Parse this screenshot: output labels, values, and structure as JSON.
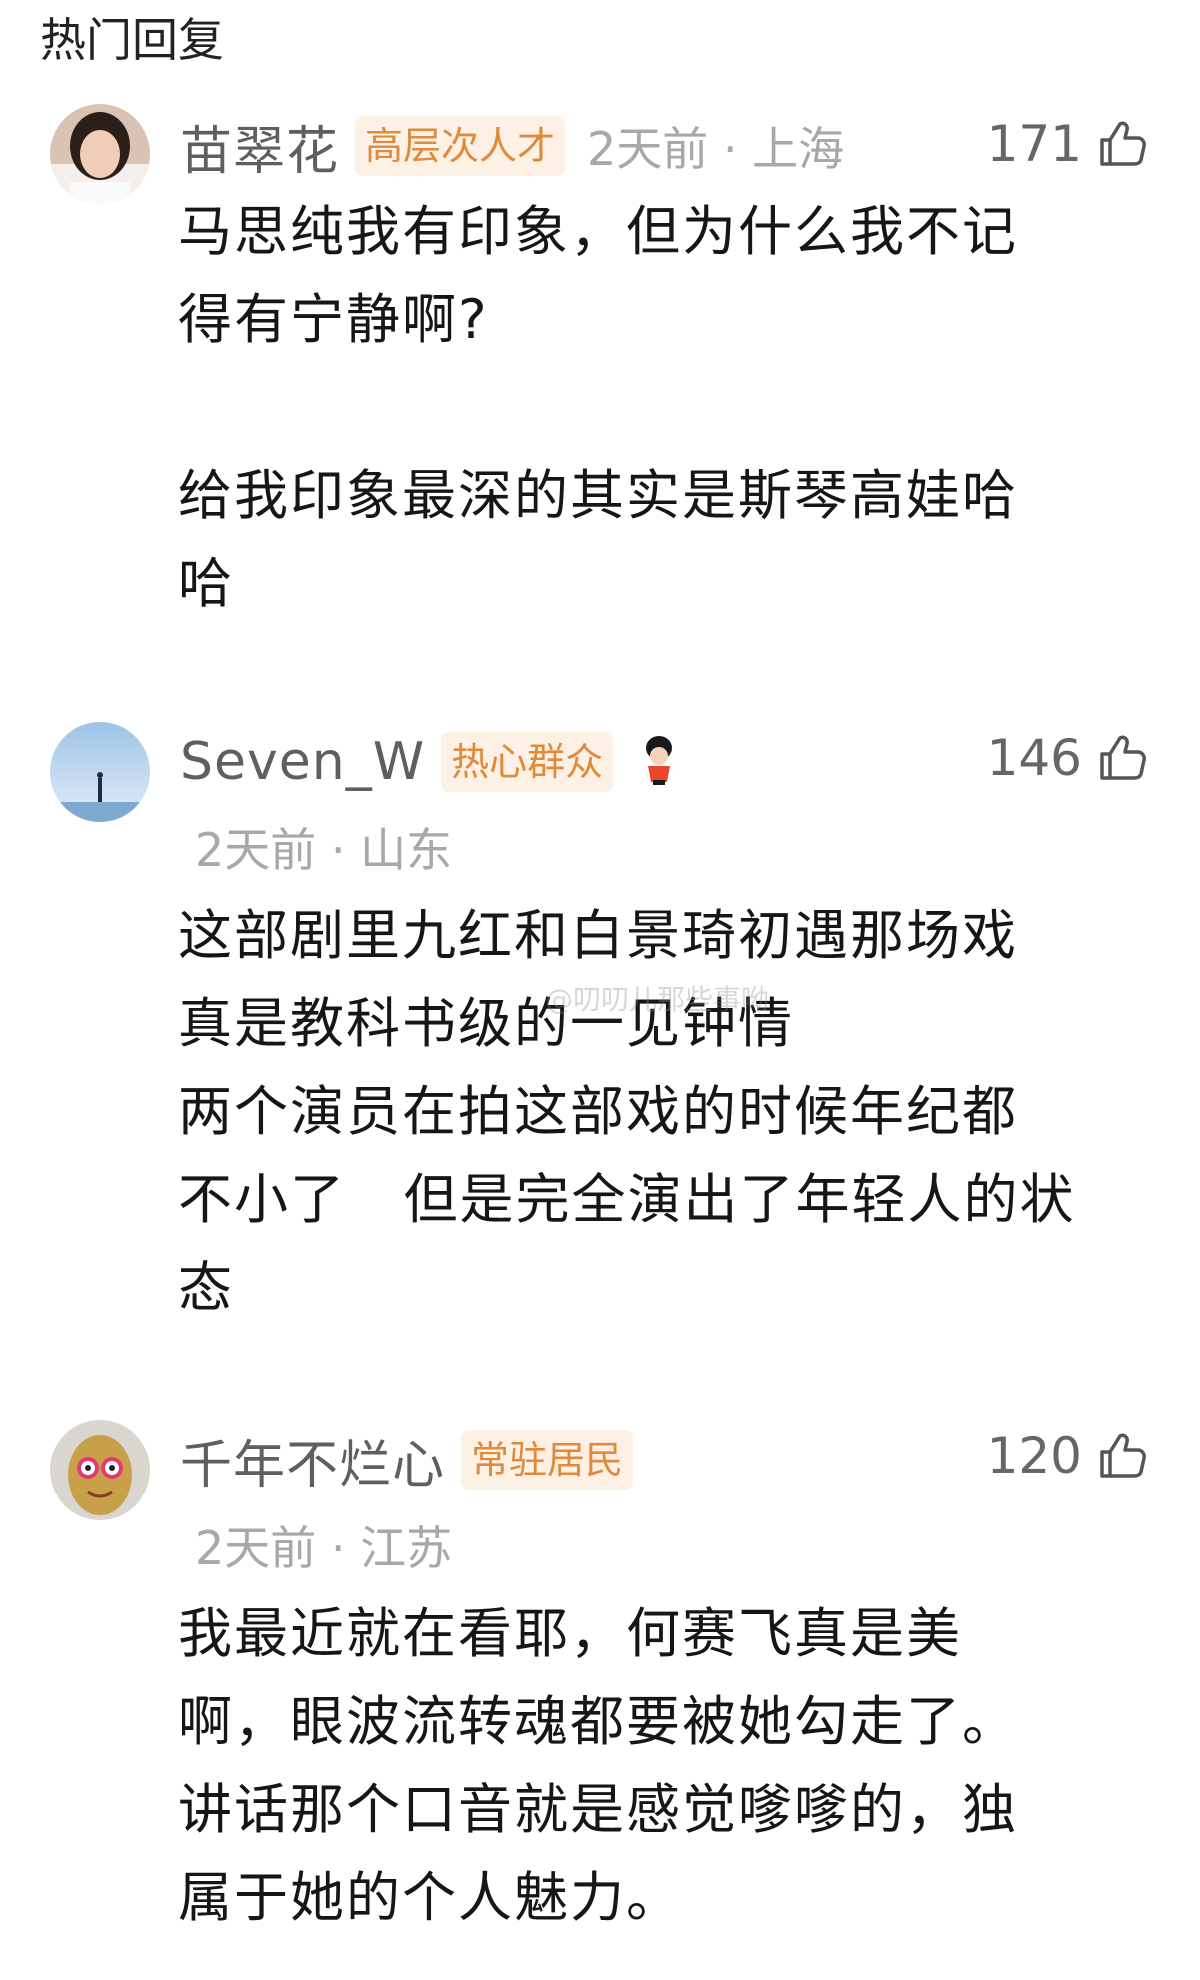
{
  "section": {
    "title": "热门回复"
  },
  "comments": [
    {
      "username": "苗翠花",
      "badge": "高层次人才",
      "time_location": "2天前 · 上海",
      "likes": "171",
      "text": "马思纯我有印象，但为什么我不记\n得有宁静啊?\n\n给我印象最深的其实是斯琴高娃哈\n哈"
    },
    {
      "username": "Seven_W",
      "badge": "热心群众",
      "time_location": "2天前 · 山东",
      "likes": "146",
      "text": "这部剧里九红和白景琦初遇那场戏\n真是教科书级的一见钟情\n两个演员在拍这部戏的时候年纪都\n不小了   但是完全演出了年轻人的状\n态"
    },
    {
      "username": "千年不烂心",
      "badge": "常驻居民",
      "time_location": "2天前 · 江苏",
      "likes": "120",
      "text": "我最近就在看耶，何赛飞真是美\n啊，眼波流转魂都要被她勾走了。\n讲话那个口音就是感觉嗲嗲的，独\n属于她的个人魅力。"
    }
  ],
  "watermark": "@叨叨儿那些事呦",
  "colors": {
    "badge_bg": "#fdf0e4",
    "badge_text": "#e08a3c",
    "username": "#5f5f5f",
    "meta": "#a8a8a8"
  },
  "icons": {
    "like": "thumbs-up-icon",
    "badge_mascot": "mascot-icon"
  }
}
